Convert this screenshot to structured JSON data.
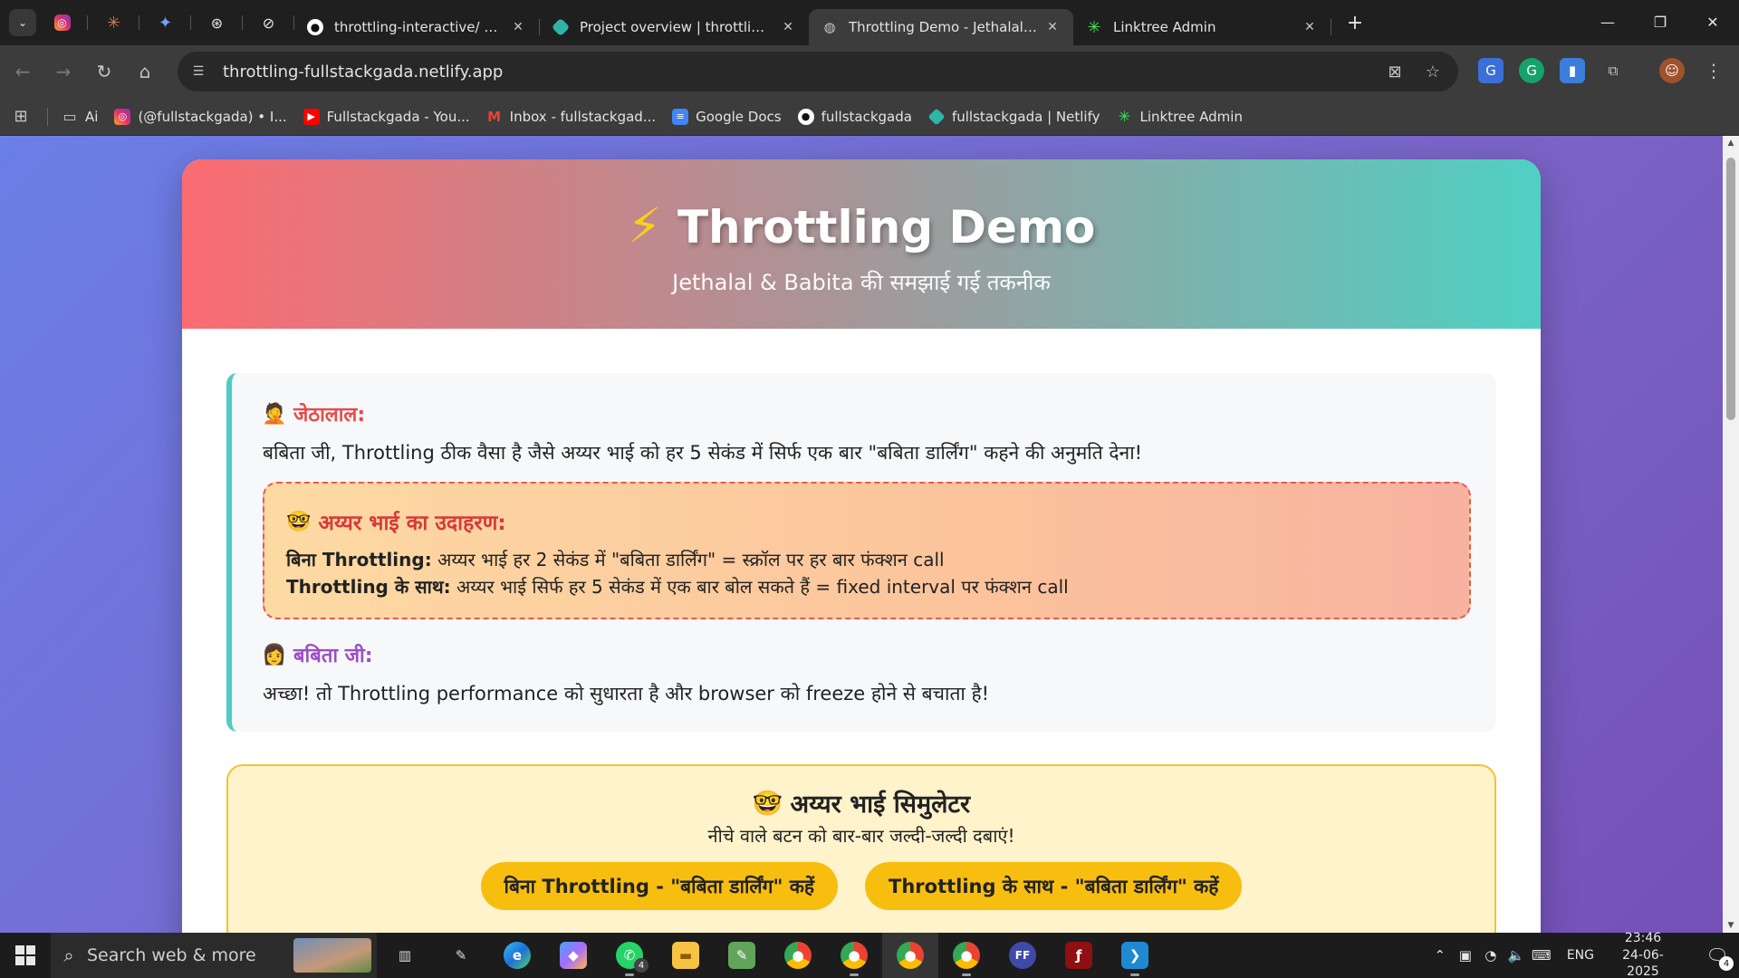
{
  "browser": {
    "tabs": [
      {
        "label": "throttling-interactive/ at main ·",
        "icon": "github-icon"
      },
      {
        "label": "Project overview | throttling-full",
        "icon": "netlify-icon"
      },
      {
        "label": "Throttling Demo - Jethalal Style",
        "icon": "globe-icon",
        "active": true
      },
      {
        "label": "Linktree Admin",
        "icon": "linktree-icon"
      }
    ],
    "url": "throttling-fullstackgada.netlify.app",
    "bookmarks": [
      {
        "label": "Ai",
        "icon": "folder-icon"
      },
      {
        "label": "(@fullstackgada) • I...",
        "icon": "instagram-icon"
      },
      {
        "label": "Fullstackgada - You...",
        "icon": "youtube-icon"
      },
      {
        "label": "Inbox - fullstackgad...",
        "icon": "gmail-icon"
      },
      {
        "label": "Google Docs",
        "icon": "google-docs-icon"
      },
      {
        "label": "fullstackgada",
        "icon": "github-icon"
      },
      {
        "label": "fullstackgada | Netlify",
        "icon": "netlify-icon"
      },
      {
        "label": "Linktree Admin",
        "icon": "linktree-icon"
      }
    ]
  },
  "page": {
    "title": "Throttling Demo",
    "subtitle": "Jethalal & Babita की समझाई गई तकनीक",
    "jethalal_name": "जेठालाल:",
    "jethalal_line": "बबिता जी, Throttling ठीक वैसा है जैसे अय्यर भाई को हर 5 सेकंड में सिर्फ एक बार \"बबिता डार्लिंग\" कहने की अनुमति देना!",
    "example_heading": "अय्यर भाई का उदाहरण:",
    "example_without_label": "बिना Throttling:",
    "example_without_text": " अय्यर भाई हर 2 सेकंड में \"बबिता डार्लिंग\" = स्क्रॉल पर हर बार फंक्शन call",
    "example_with_label": "Throttling के साथ:",
    "example_with_text": " अय्यर भाई सिर्फ हर 5 सेकंड में एक बार बोल सकते हैं = fixed interval पर फंक्शन call",
    "babita_name": "बबिता जी:",
    "babita_line": "अच्छा! तो Throttling performance को सुधारता है और browser को freeze होने से बचाता है!",
    "sim_title": "अय्यर भाई सिमुलेटर",
    "sim_subtitle": "नीचे वाले बटन को बार-बार जल्दी-जल्दी दबाएं!",
    "btn_without": "बिना Throttling - \"बबिता डार्लिंग\" कहें",
    "btn_with": "Throttling के साथ - \"बबिता डार्लिंग\" कहें"
  },
  "taskbar": {
    "search_placeholder": "Search web & more",
    "whatsapp_badge": "4",
    "lang": "ENG",
    "time": "23:46",
    "date": "24-06-2025",
    "notif_badge": "4"
  },
  "colors": {
    "accent_teal": "#4ecdc4",
    "jethalal": "#e84a4a",
    "babita": "#9b4fc4",
    "sim_button": "#f7be10"
  }
}
